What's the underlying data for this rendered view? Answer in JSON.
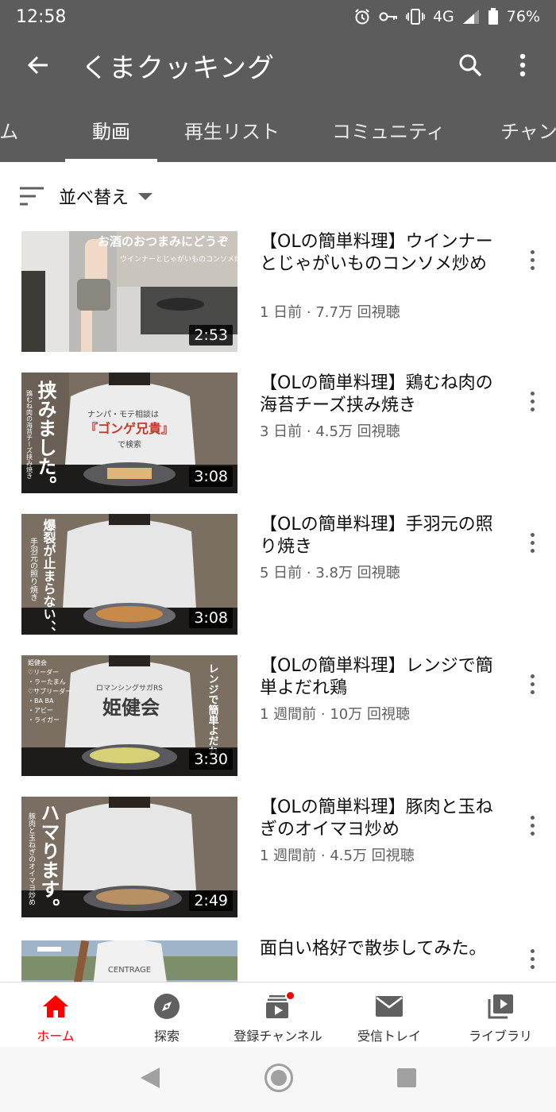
{
  "status_bar": {
    "time": "12:58",
    "network": "4G",
    "battery": "76%"
  },
  "app_bar": {
    "title": "くまクッキング"
  },
  "tabs": [
    {
      "label": "ホーム"
    },
    {
      "label": "動画"
    },
    {
      "label": "再生リスト"
    },
    {
      "label": "コミュニティ"
    },
    {
      "label": "チャンネル"
    }
  ],
  "sort": {
    "label": "並べ替え"
  },
  "videos": [
    {
      "title": "【OLの簡単料理】ウインナーとじゃがいものコンソメ炒め",
      "meta": "1 日前 · 7.7万 回視聴",
      "duration": "2:53",
      "thumb_text": "お酒のおつまみにどうぞ",
      "thumb_sub": "ウインナーとじゃがいものコンソメ炒め"
    },
    {
      "title": "【OLの簡単料理】鶏むね肉の海苔チーズ挟み焼き",
      "meta": "3 日前 · 4.5万 回視聴",
      "duration": "3:08",
      "thumb_text": "挟みました。",
      "thumb_sub": "鶏むね肉の海苔チーズ挟み焼き",
      "shirt_line1": "ナンパ・モテ相談は",
      "shirt_line2": "『ゴンゲ兄貴』",
      "shirt_line3": "で検索"
    },
    {
      "title": "【OLの簡単料理】手羽元の照り焼き",
      "meta": "5 日前 · 3.8万 回視聴",
      "duration": "3:08",
      "thumb_text": "爆裂が止まらない、、",
      "thumb_sub": "手羽元の照り焼き"
    },
    {
      "title": "【OLの簡単料理】レンジで簡単よだれ鶏",
      "meta": "1 週間前 · 10万 回視聴",
      "duration": "3:30",
      "thumb_text": "レンジで簡単よだれ",
      "thumb_list": [
        "姫健会",
        "♡リーダー",
        "・ラーたまん",
        "♡サブリーダー",
        "・BA BA",
        "・アビー",
        "・ライガー"
      ],
      "shirt_line1": "ロマンシングサガRS",
      "shirt_line2": "姫健会"
    },
    {
      "title": "【OLの簡単料理】豚肉と玉ねぎのオイマヨ炒め",
      "meta": "1 週間前 · 4.5万 回視聴",
      "duration": "2:49",
      "thumb_text": "ハマります。",
      "thumb_sub": "豚肉と玉ねぎのオイマヨ炒め"
    },
    {
      "title": "面白い格好で散歩してみた。",
      "meta": "",
      "duration": "",
      "thumb_text": "",
      "shirt_line1": "CENTRAGE"
    }
  ],
  "bottom_nav": [
    {
      "label": "ホーム",
      "icon": "home-icon"
    },
    {
      "label": "探索",
      "icon": "explore-icon"
    },
    {
      "label": "登録チャンネル",
      "icon": "subscriptions-icon"
    },
    {
      "label": "受信トレイ",
      "icon": "inbox-icon"
    },
    {
      "label": "ライブラリ",
      "icon": "library-icon"
    }
  ],
  "colors": {
    "appbar": "#5c5c5c",
    "accent": "#ff0000",
    "meta_text": "#606060"
  }
}
